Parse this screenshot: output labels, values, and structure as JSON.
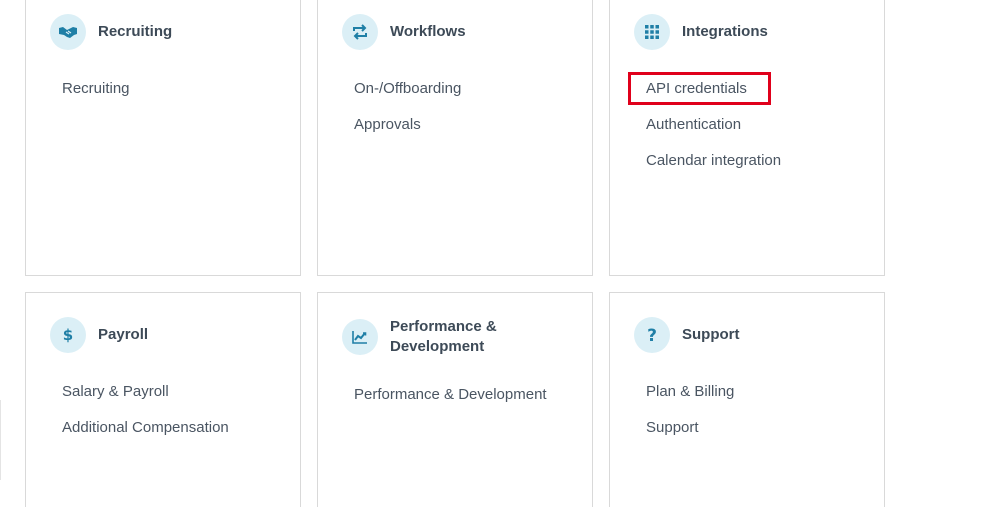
{
  "cards": [
    {
      "id": "recruiting",
      "title": "Recruiting",
      "icon": "handshake-icon",
      "links": [
        "Recruiting"
      ]
    },
    {
      "id": "workflows",
      "title": "Workflows",
      "icon": "repeat-icon",
      "links": [
        "On-/Offboarding",
        "Approvals"
      ]
    },
    {
      "id": "integrations",
      "title": "Integrations",
      "icon": "grid-icon",
      "links": [
        "API credentials",
        "Authentication",
        "Calendar integration"
      ]
    },
    {
      "id": "payroll",
      "title": "Payroll",
      "icon": "dollar-icon",
      "links": [
        "Salary & Payroll",
        "Additional Compensation"
      ]
    },
    {
      "id": "performance",
      "title_line1": "Performance &",
      "title_line2": "Development",
      "icon": "trend-chart-icon",
      "links": [
        "Performance & Development"
      ]
    },
    {
      "id": "support",
      "title": "Support",
      "icon": "question-icon",
      "links": [
        "Plan & Billing",
        "Support"
      ]
    }
  ],
  "colors": {
    "icon_bg": "#dbeff6",
    "icon_fg": "#1f7fa6",
    "title": "#3d4a57",
    "link": "#4a5562",
    "border": "#d9d9d9",
    "highlight": "#e0001b"
  },
  "highlighted_link": "API credentials"
}
